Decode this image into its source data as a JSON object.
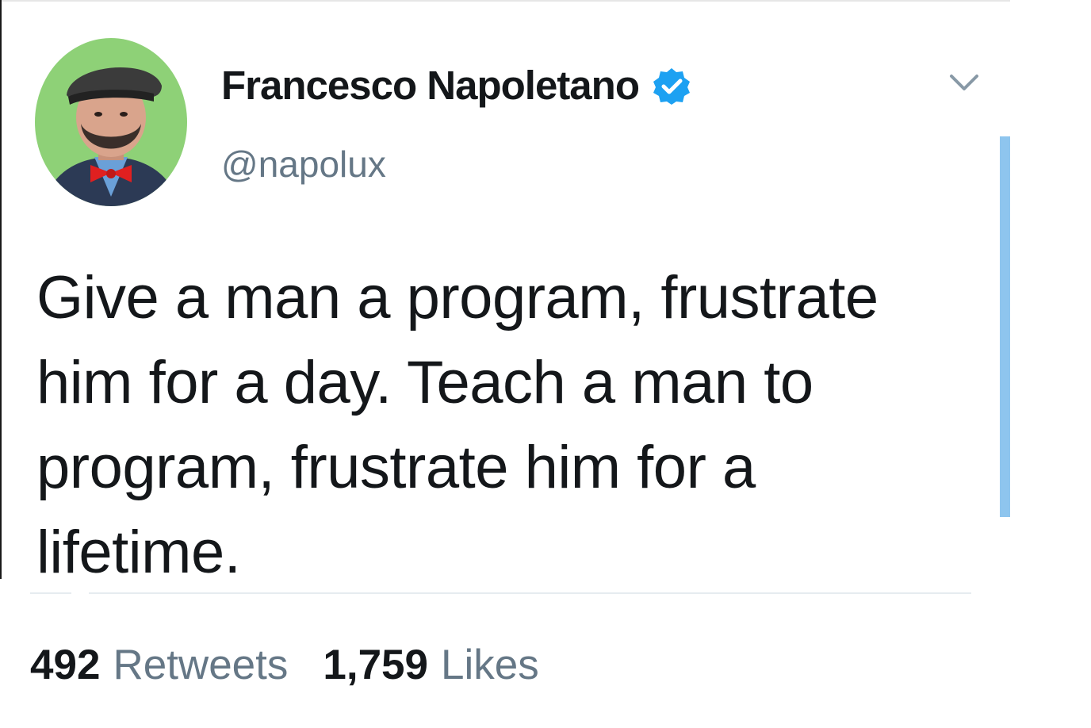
{
  "tweet": {
    "author": {
      "display_name": "Francesco Napoletano",
      "handle": "@napolux",
      "verified": true,
      "avatar_icon": "user-avatar-photo"
    },
    "text": "Give a man a program, frustrate him for a day. Teach a man to program, frustrate him for a lifetime.",
    "menu_icon": "chevron-down-icon",
    "stats": {
      "retweets_count": "492",
      "retweets_label": "Retweets",
      "likes_count": "1,759",
      "likes_label": "Likes"
    }
  },
  "colors": {
    "text": "#14171a",
    "secondary": "#657786",
    "verified_badge": "#1da1f2",
    "scrollbar": "#8ec5ee",
    "divider": "#e6ecf0",
    "avatar_bg": "#8ed177"
  }
}
